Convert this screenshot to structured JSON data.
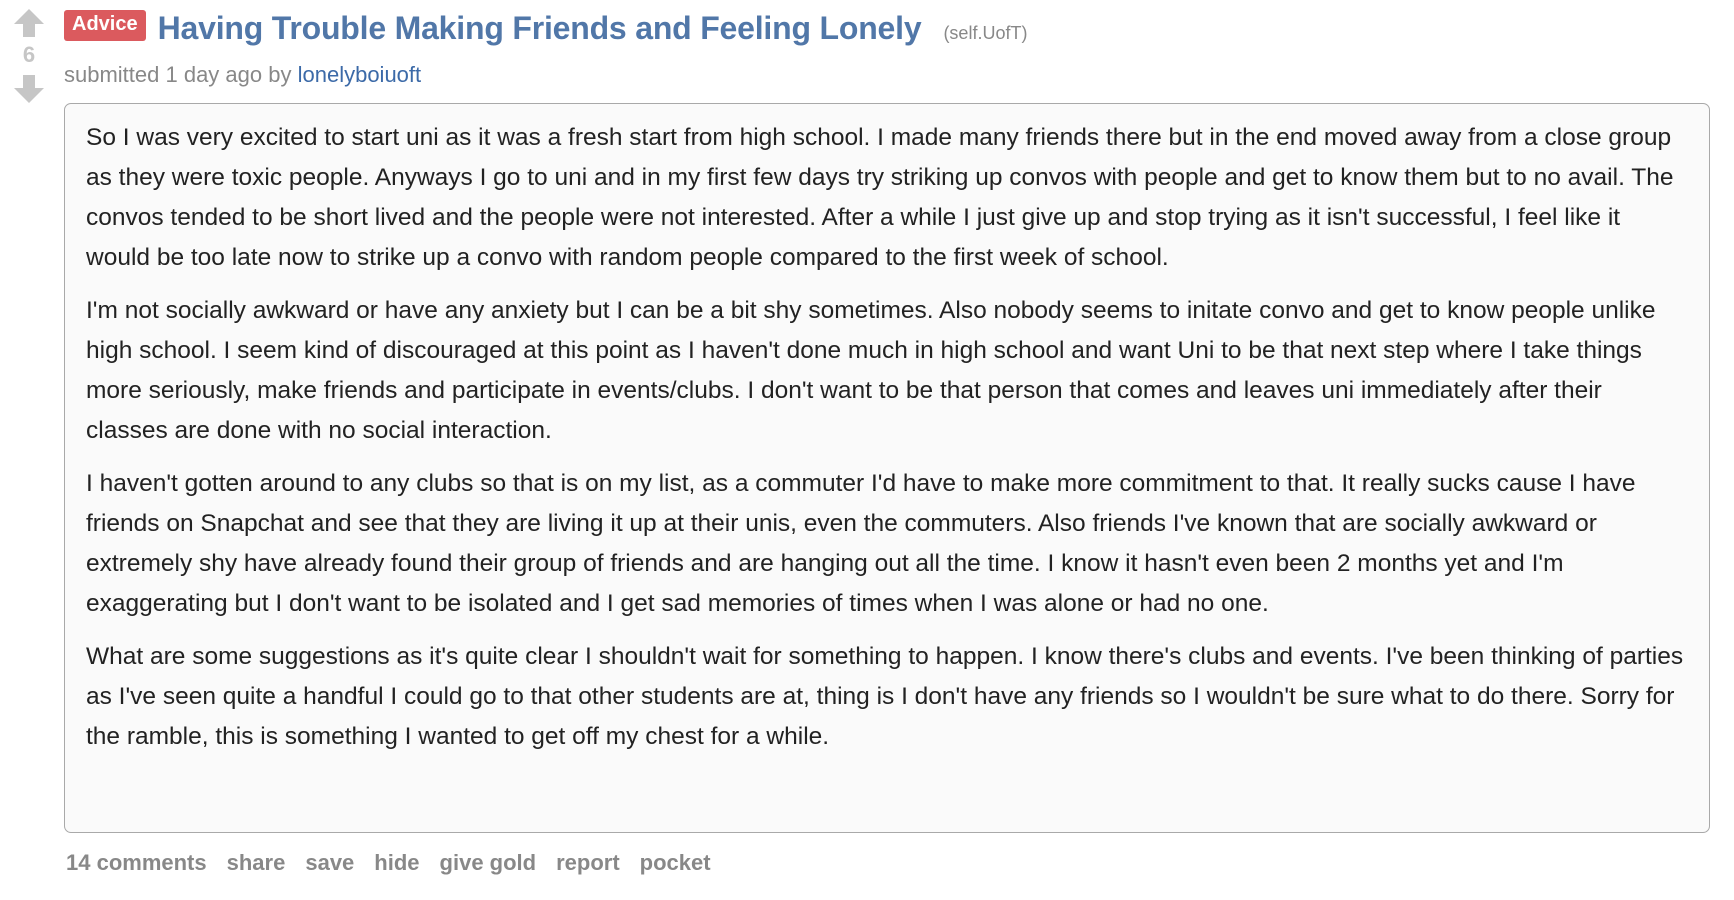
{
  "post": {
    "score": "6",
    "flair": "Advice",
    "title": "Having Trouble Making Friends and Feeling Lonely",
    "domain": "(self.UofT)",
    "tagline": {
      "submitted_prefix": "submitted 1 day ago by",
      "author": "lonelyboiuoft"
    },
    "paragraphs": [
      "So I was very excited to start uni as it was a fresh start from high school. I made many friends there but in the end moved away from a close group as they were toxic people. Anyways I go to uni and in my first few days try striking up convos with people and get to know them but to no avail. The convos tended to be short lived and the people were not interested. After a while I just give up and stop trying as it isn't successful, I feel like it would be too late now to strike up a convo with random people compared to the first week of school.",
      "I'm not socially awkward or have any anxiety but I can be a bit shy sometimes. Also nobody seems to initate convo and get to know people unlike high school. I seem kind of discouraged at this point as I haven't done much in high school and want Uni to be that next step where I take things more seriously, make friends and participate in events/clubs. I don't want to be that person that comes and leaves uni immediately after their classes are done with no social interaction.",
      "I haven't gotten around to any clubs so that is on my list, as a commuter I'd have to make more commitment to that. It really sucks cause I have friends on Snapchat and see that they are living it up at their unis, even the commuters. Also friends I've known that are socially awkward or extremely shy have already found their group of friends and are hanging out all the time. I know it hasn't even been 2 months yet and I'm exaggerating but I don't want to be isolated and I get sad memories of times when I was alone or had no one.",
      "What are some suggestions as it's quite clear I shouldn't wait for something to happen. I know there's clubs and events. I've been thinking of parties as I've seen quite a handful I could go to that other students are at, thing is I don't have any friends so I wouldn't be sure what to do there. Sorry for the ramble, this is something I wanted to get off my chest for a while."
    ],
    "buttons": {
      "comments": "14 comments",
      "share": "share",
      "save": "save",
      "hide": "hide",
      "give_gold": "give gold",
      "report": "report",
      "pocket": "pocket"
    }
  },
  "icons": {
    "upvote": "upvote-arrow-icon",
    "downvote": "downvote-arrow-icon"
  },
  "colors": {
    "title": "#5177a8",
    "flair_bg": "#db5a5e",
    "author": "#3c6aa8",
    "muted": "#888888",
    "arrow": "#c6c6c6"
  }
}
